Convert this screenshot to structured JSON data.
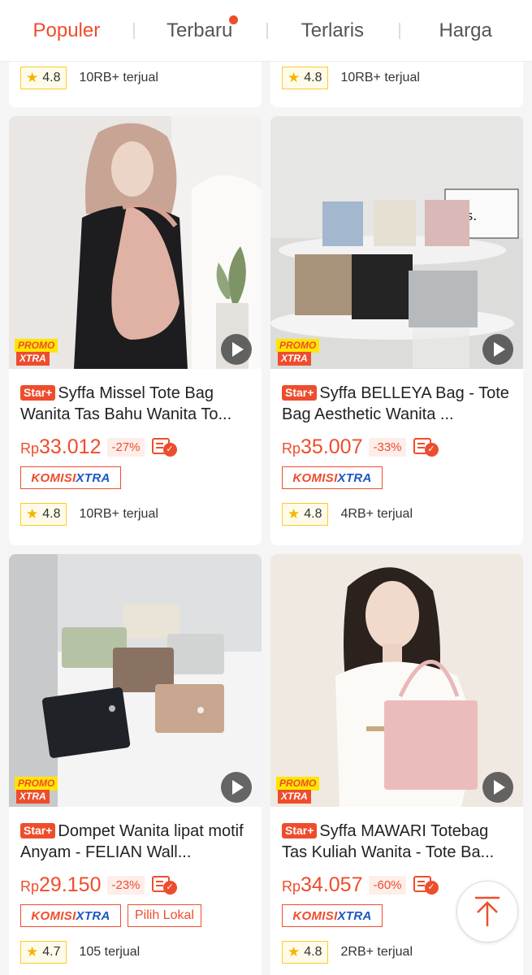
{
  "tabs": [
    {
      "label": "Populer",
      "active": true
    },
    {
      "label": "Terbaru",
      "active": false,
      "dot": true
    },
    {
      "label": "Terlaris",
      "active": false
    },
    {
      "label": "Harga",
      "active": false
    }
  ],
  "top_cards": [
    {
      "rating": "4.8",
      "sold": "10RB+ terjual"
    },
    {
      "rating": "4.8",
      "sold": "10RB+ terjual"
    }
  ],
  "products": [
    {
      "badge": "Star+",
      "title": "Syffa Missel Tote Bag Wanita Tas Bahu Wanita To...",
      "currency": "Rp",
      "price": "33.012",
      "discount": "-27%",
      "tags": [
        "KOMISI XTRA"
      ],
      "rating": "4.8",
      "sold": "10RB+ terjual",
      "promo_line1": "PROMO",
      "promo_line2": "XTRA"
    },
    {
      "badge": "Star+",
      "title": "Syffa BELLEYA  Bag - Tote Bag Aesthetic Wanita ...",
      "currency": "Rp",
      "price": "35.007",
      "discount": "-33%",
      "tags": [
        "KOMISI XTRA"
      ],
      "rating": "4.8",
      "sold": "4RB+ terjual",
      "promo_line1": "PROMO",
      "promo_line2": "XTRA"
    },
    {
      "badge": "Star+",
      "title": "Dompet Wanita lipat motif Anyam - FELIAN Wall...",
      "currency": "Rp",
      "price": "29.150",
      "discount": "-23%",
      "tags": [
        "KOMISI XTRA",
        "Pilih Lokal"
      ],
      "rating": "4.7",
      "sold": "105 terjual",
      "promo_line1": "PROMO",
      "promo_line2": "XTRA"
    },
    {
      "badge": "Star+",
      "title": "Syffa MAWARI Totebag Tas Kuliah Wanita - Tote Ba...",
      "currency": "Rp",
      "price": "34.057",
      "discount": "-60%",
      "tags": [
        "KOMISI XTRA"
      ],
      "rating": "4.8",
      "sold": "2RB+ terjual",
      "promo_line1": "PROMO",
      "promo_line2": "XTRA"
    }
  ],
  "komisi": {
    "part1": "KOMISI",
    "part2": "XTRA"
  },
  "pilih_lokal": "Pilih Lokal",
  "colors": {
    "accent": "#ee4d2d",
    "komisi_blue": "#1a56c4",
    "promo_yellow": "#ffe600",
    "rating_border": "#ffca28"
  }
}
